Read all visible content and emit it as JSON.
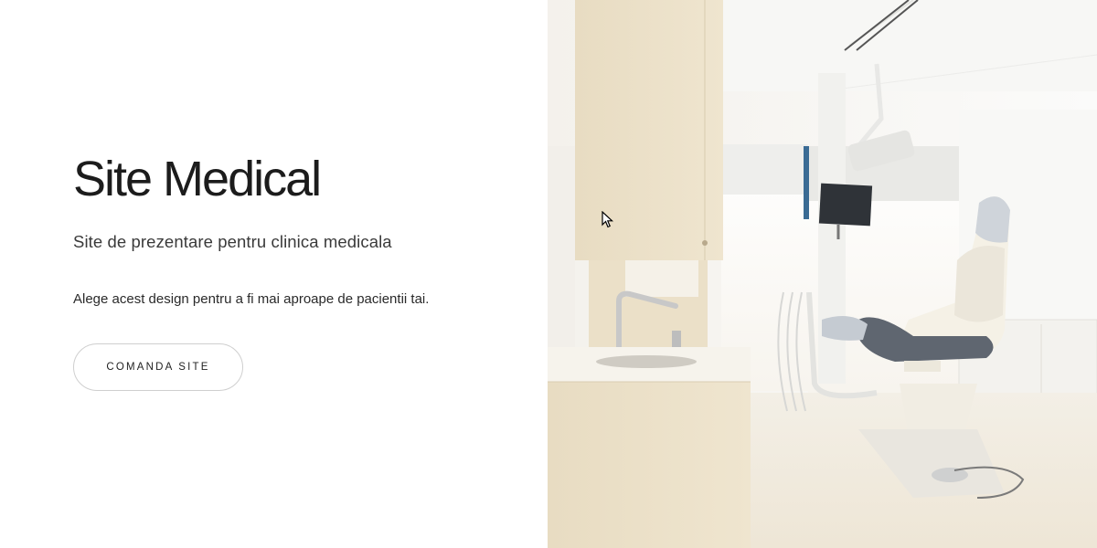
{
  "hero": {
    "title": "Site Medical",
    "subtitle": "Site de prezentare pentru clinica medicala",
    "description": "Alege acest design pentru a fi mai aproape de pacientii tai.",
    "cta_label": "COMANDA SITE"
  },
  "image": {
    "subject": "dental-clinic-photo"
  },
  "colors": {
    "background": "#ffffff",
    "text": "#1c1c1c",
    "button_border": "#cfcfcf"
  }
}
